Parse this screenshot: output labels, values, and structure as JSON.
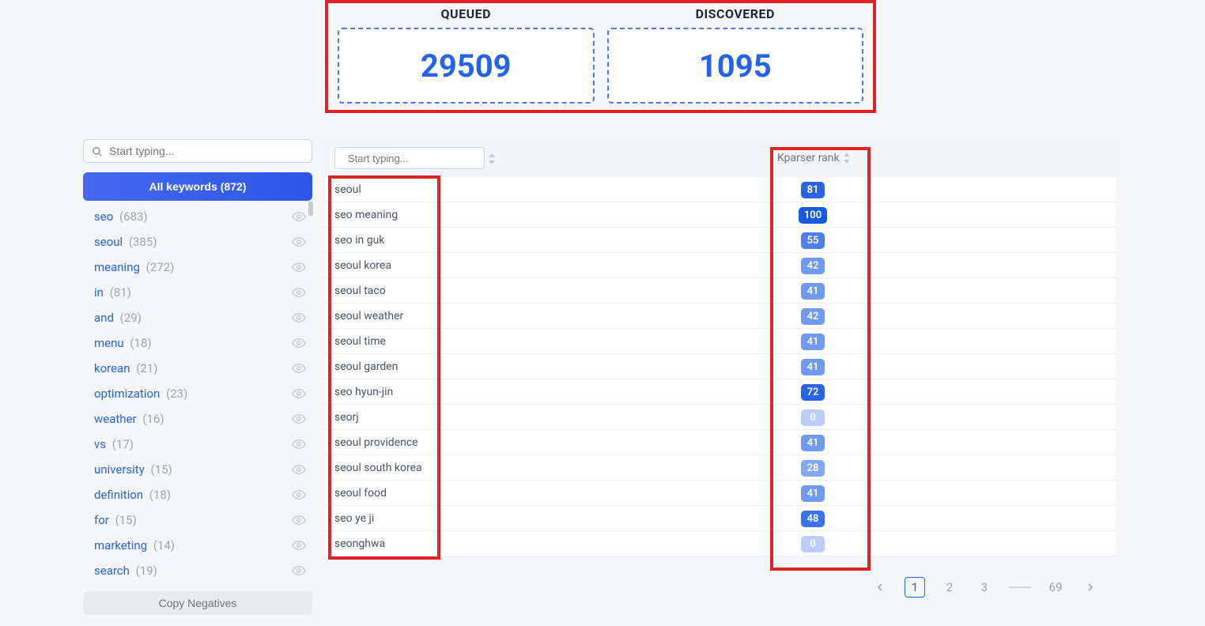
{
  "stats": {
    "queued": {
      "label": "QUEUED",
      "value": "29509"
    },
    "discovered": {
      "label": "DISCOVERED",
      "value": "1095"
    }
  },
  "sidebar": {
    "search_placeholder": "Start typing...",
    "all_label": "All keywords (872)",
    "copy_negatives": "Copy Negatives",
    "items": [
      {
        "word": "seo",
        "count": "(683)"
      },
      {
        "word": "seoul",
        "count": "(385)"
      },
      {
        "word": "meaning",
        "count": "(272)"
      },
      {
        "word": "in",
        "count": "(81)"
      },
      {
        "word": "and",
        "count": "(29)"
      },
      {
        "word": "menu",
        "count": "(18)"
      },
      {
        "word": "korean",
        "count": "(21)"
      },
      {
        "word": "optimization",
        "count": "(23)"
      },
      {
        "word": "weather",
        "count": "(16)"
      },
      {
        "word": "vs",
        "count": "(17)"
      },
      {
        "word": "university",
        "count": "(15)"
      },
      {
        "word": "definition",
        "count": "(18)"
      },
      {
        "word": "for",
        "count": "(15)"
      },
      {
        "word": "marketing",
        "count": "(14)"
      },
      {
        "word": "search",
        "count": "(19)"
      }
    ]
  },
  "table": {
    "search_placeholder": "Start typing...",
    "rank_header": "Kparser rank",
    "rows": [
      {
        "kw": "seoul",
        "rank": "81",
        "shade": "dark"
      },
      {
        "kw": "seo meaning",
        "rank": "100",
        "shade": "darkest"
      },
      {
        "kw": "seo in guk",
        "rank": "55",
        "shade": "mid"
      },
      {
        "kw": "seoul korea",
        "rank": "42",
        "shade": "light"
      },
      {
        "kw": "seoul taco",
        "rank": "41",
        "shade": "light"
      },
      {
        "kw": "seoul weather",
        "rank": "42",
        "shade": "light"
      },
      {
        "kw": "seoul time",
        "rank": "41",
        "shade": "light"
      },
      {
        "kw": "seoul garden",
        "rank": "41",
        "shade": "light"
      },
      {
        "kw": "seo hyun-jin",
        "rank": "72",
        "shade": "dark"
      },
      {
        "kw": "seorj",
        "rank": "0",
        "shade": "pale"
      },
      {
        "kw": "seoul providence",
        "rank": "41",
        "shade": "light"
      },
      {
        "kw": "seoul south korea",
        "rank": "28",
        "shade": "light2"
      },
      {
        "kw": "seoul food",
        "rank": "41",
        "shade": "light"
      },
      {
        "kw": "seo ye ji",
        "rank": "48",
        "shade": "mid2"
      },
      {
        "kw": "seonghwa",
        "rank": "0",
        "shade": "pale"
      }
    ],
    "shades": {
      "darkest": "#1859e0",
      "dark": "#2a63e6",
      "mid": "#4d80ee",
      "mid2": "#3a72ea",
      "light": "#6f99f2",
      "light2": "#83a7f4",
      "pale": "#b9cdf8"
    }
  },
  "pagination": {
    "pages": [
      "1",
      "2",
      "3"
    ],
    "last": "69",
    "active": "1"
  }
}
